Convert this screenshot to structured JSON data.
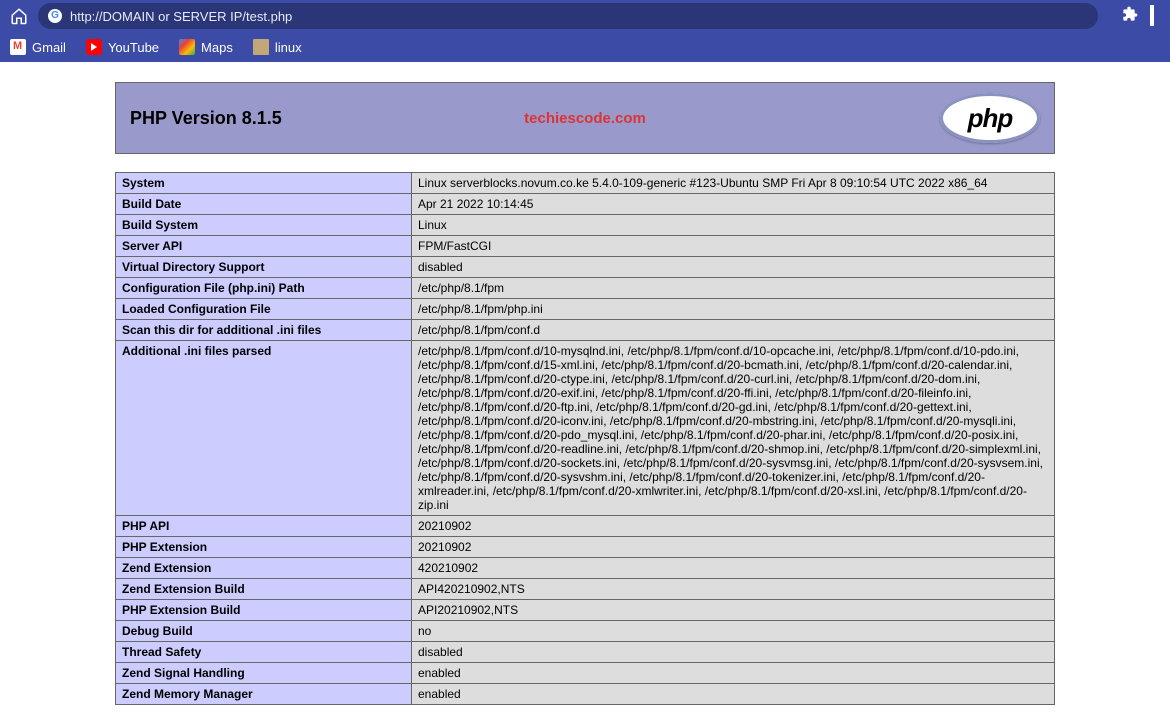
{
  "browser": {
    "url": "http://DOMAIN or SERVER IP/test.php",
    "bookmarks": [
      {
        "label": "Gmail",
        "icon": "gmail"
      },
      {
        "label": "YouTube",
        "icon": "youtube"
      },
      {
        "label": "Maps",
        "icon": "maps"
      },
      {
        "label": "linux",
        "icon": "folder"
      }
    ]
  },
  "watermark": "techiescode.com",
  "phpinfo": {
    "title": "PHP Version 8.1.5",
    "logo_text": "php",
    "rows": [
      {
        "k": "System",
        "v": "Linux serverblocks.novum.co.ke 5.4.0-109-generic #123-Ubuntu SMP Fri Apr 8 09:10:54 UTC 2022 x86_64"
      },
      {
        "k": "Build Date",
        "v": "Apr 21 2022 10:14:45"
      },
      {
        "k": "Build System",
        "v": "Linux"
      },
      {
        "k": "Server API",
        "v": "FPM/FastCGI"
      },
      {
        "k": "Virtual Directory Support",
        "v": "disabled"
      },
      {
        "k": "Configuration File (php.ini) Path",
        "v": "/etc/php/8.1/fpm"
      },
      {
        "k": "Loaded Configuration File",
        "v": "/etc/php/8.1/fpm/php.ini"
      },
      {
        "k": "Scan this dir for additional .ini files",
        "v": "/etc/php/8.1/fpm/conf.d"
      },
      {
        "k": "Additional .ini files parsed",
        "v": "/etc/php/8.1/fpm/conf.d/10-mysqlnd.ini, /etc/php/8.1/fpm/conf.d/10-opcache.ini, /etc/php/8.1/fpm/conf.d/10-pdo.ini, /etc/php/8.1/fpm/conf.d/15-xml.ini, /etc/php/8.1/fpm/conf.d/20-bcmath.ini, /etc/php/8.1/fpm/conf.d/20-calendar.ini, /etc/php/8.1/fpm/conf.d/20-ctype.ini, /etc/php/8.1/fpm/conf.d/20-curl.ini, /etc/php/8.1/fpm/conf.d/20-dom.ini, /etc/php/8.1/fpm/conf.d/20-exif.ini, /etc/php/8.1/fpm/conf.d/20-ffi.ini, /etc/php/8.1/fpm/conf.d/20-fileinfo.ini, /etc/php/8.1/fpm/conf.d/20-ftp.ini, /etc/php/8.1/fpm/conf.d/20-gd.ini, /etc/php/8.1/fpm/conf.d/20-gettext.ini, /etc/php/8.1/fpm/conf.d/20-iconv.ini, /etc/php/8.1/fpm/conf.d/20-mbstring.ini, /etc/php/8.1/fpm/conf.d/20-mysqli.ini, /etc/php/8.1/fpm/conf.d/20-pdo_mysql.ini, /etc/php/8.1/fpm/conf.d/20-phar.ini, /etc/php/8.1/fpm/conf.d/20-posix.ini, /etc/php/8.1/fpm/conf.d/20-readline.ini, /etc/php/8.1/fpm/conf.d/20-shmop.ini, /etc/php/8.1/fpm/conf.d/20-simplexml.ini, /etc/php/8.1/fpm/conf.d/20-sockets.ini, /etc/php/8.1/fpm/conf.d/20-sysvmsg.ini, /etc/php/8.1/fpm/conf.d/20-sysvsem.ini, /etc/php/8.1/fpm/conf.d/20-sysvshm.ini, /etc/php/8.1/fpm/conf.d/20-tokenizer.ini, /etc/php/8.1/fpm/conf.d/20-xmlreader.ini, /etc/php/8.1/fpm/conf.d/20-xmlwriter.ini, /etc/php/8.1/fpm/conf.d/20-xsl.ini, /etc/php/8.1/fpm/conf.d/20-zip.ini"
      },
      {
        "k": "PHP API",
        "v": "20210902"
      },
      {
        "k": "PHP Extension",
        "v": "20210902"
      },
      {
        "k": "Zend Extension",
        "v": "420210902"
      },
      {
        "k": "Zend Extension Build",
        "v": "API420210902,NTS"
      },
      {
        "k": "PHP Extension Build",
        "v": "API20210902,NTS"
      },
      {
        "k": "Debug Build",
        "v": "no"
      },
      {
        "k": "Thread Safety",
        "v": "disabled"
      },
      {
        "k": "Zend Signal Handling",
        "v": "enabled"
      },
      {
        "k": "Zend Memory Manager",
        "v": "enabled"
      }
    ]
  }
}
